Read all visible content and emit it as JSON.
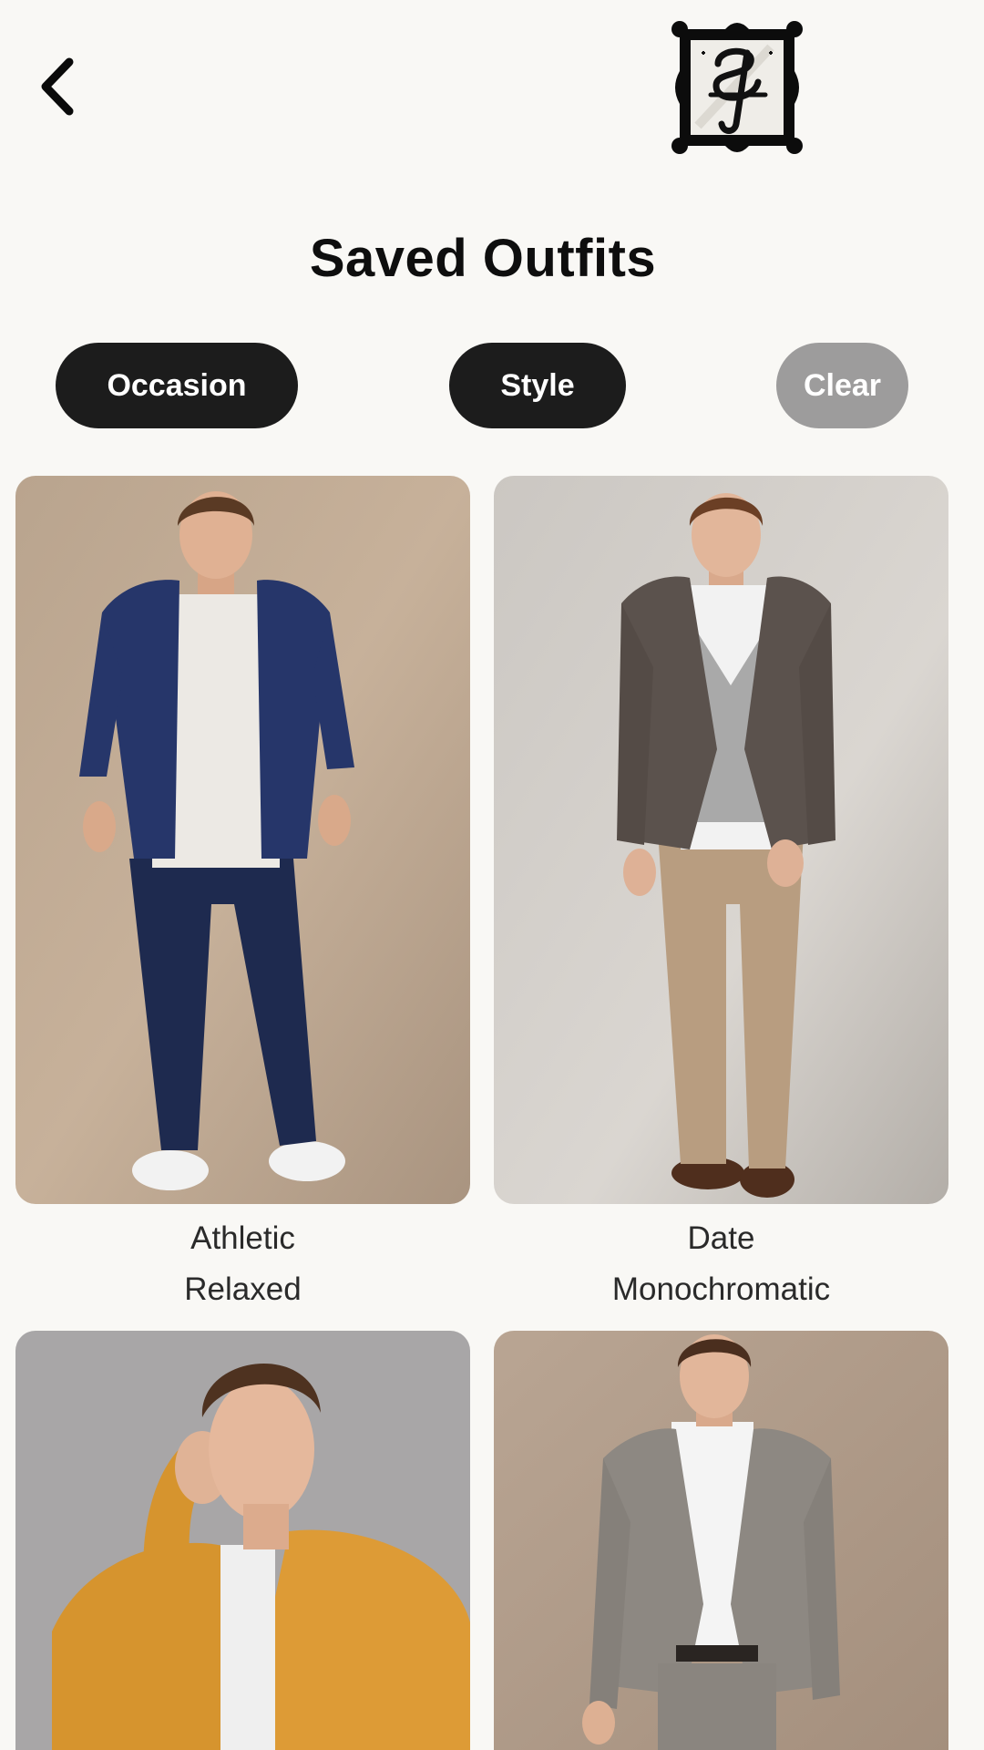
{
  "header": {
    "back_icon": "chevron-left-icon",
    "logo_icon": "monogram-frame-logo",
    "title": "Saved Outfits"
  },
  "filters": {
    "occasion_label": "Occasion",
    "style_label": "Style",
    "clear_label": "Clear"
  },
  "outfits": [
    {
      "occasion": "Athletic",
      "style": "Relaxed",
      "image": "man-navy-bomber-jacket-joggers-sneakers"
    },
    {
      "occasion": "Date",
      "style": "Monochromatic",
      "image": "man-brown-blazer-grey-sweater-khaki-pants"
    },
    {
      "image": "man-mustard-bomber-jacket-white-tee"
    },
    {
      "image": "man-grey-plaid-suit-white-shirt"
    }
  ],
  "colors": {
    "background": "#f9f8f5",
    "chip_active": "#1c1c1c",
    "chip_disabled": "#9d9c9c"
  }
}
